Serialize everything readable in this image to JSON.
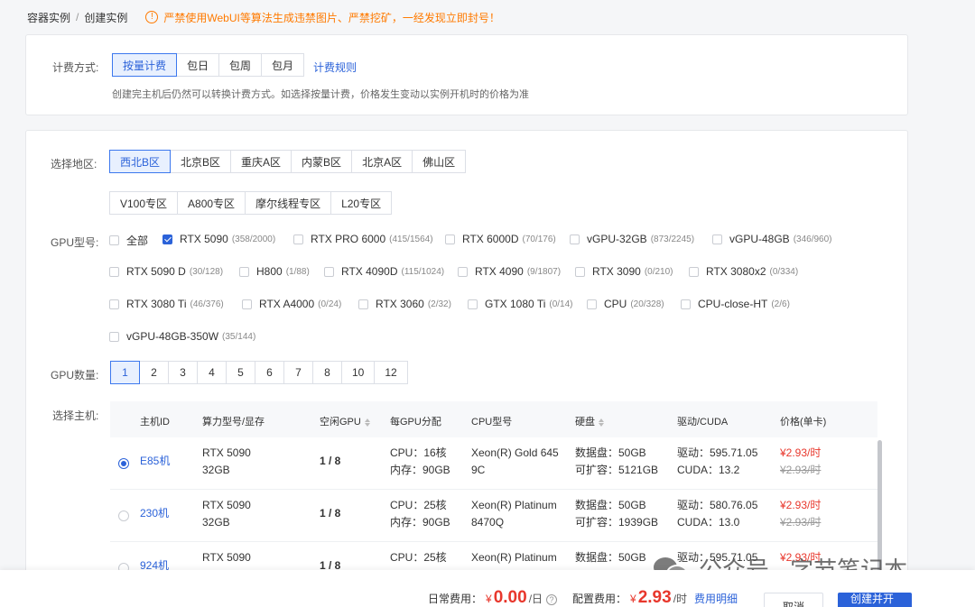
{
  "breadcrumb": {
    "parent": "容器实例",
    "sep": "/",
    "current": "创建实例"
  },
  "warning": {
    "icon": "exclamation-circle-icon",
    "text": "严禁使用WebUI等算法生成违禁图片、严禁挖矿，一经发现立即封号！"
  },
  "billing": {
    "label": "计费方式:",
    "options": [
      "按量计费",
      "包日",
      "包周",
      "包月"
    ],
    "selected": "按量计费",
    "rules_link": "计费规则",
    "hint": "创建完主机后仍然可以转换计费方式。如选择按量计费，价格发生变动以实例开机时的价格为准"
  },
  "region": {
    "label": "选择地区:",
    "row1": [
      "西北B区",
      "北京B区",
      "重庆A区",
      "内蒙B区",
      "北京A区",
      "佛山区"
    ],
    "row2": [
      "V100专区",
      "A800专区",
      "摩尔线程专区",
      "L20专区"
    ],
    "selected": "西北B区"
  },
  "gpu_type": {
    "label": "GPU型号:",
    "items": [
      {
        "name": "全部",
        "count": "",
        "checked": false
      },
      {
        "name": "RTX 5090",
        "count": "(358/2000)",
        "checked": true
      },
      {
        "name": "RTX PRO 6000",
        "count": "(415/1564)",
        "checked": false
      },
      {
        "name": "RTX 6000D",
        "count": "(70/176)",
        "checked": false
      },
      {
        "name": "vGPU-32GB",
        "count": "(873/2245)",
        "checked": false
      },
      {
        "name": "vGPU-48GB",
        "count": "(346/960)",
        "checked": false
      },
      {
        "name": "RTX 5090 D",
        "count": "(30/128)",
        "checked": false
      },
      {
        "name": "H800",
        "count": "(1/88)",
        "checked": false
      },
      {
        "name": "RTX 4090D",
        "count": "(115/1024)",
        "checked": false
      },
      {
        "name": "RTX 4090",
        "count": "(9/1807)",
        "checked": false
      },
      {
        "name": "RTX 3090",
        "count": "(0/210)",
        "checked": false
      },
      {
        "name": "RTX 3080x2",
        "count": "(0/334)",
        "checked": false
      },
      {
        "name": "RTX 3080 Ti",
        "count": "(46/376)",
        "checked": false
      },
      {
        "name": "RTX A4000",
        "count": "(0/24)",
        "checked": false
      },
      {
        "name": "RTX 3060",
        "count": "(2/32)",
        "checked": false
      },
      {
        "name": "GTX 1080 Ti",
        "count": "(0/14)",
        "checked": false
      },
      {
        "name": "CPU",
        "count": "(20/328)",
        "checked": false
      },
      {
        "name": "CPU-close-HT",
        "count": "(2/6)",
        "checked": false
      },
      {
        "name": "vGPU-48GB-350W",
        "count": "(35/144)",
        "checked": false
      }
    ]
  },
  "gpu_count": {
    "label": "GPU数量:",
    "options": [
      "1",
      "2",
      "3",
      "4",
      "5",
      "6",
      "7",
      "8",
      "10",
      "12"
    ],
    "selected": "1"
  },
  "host": {
    "label": "选择主机:",
    "columns": [
      "主机ID",
      "算力型号/显存",
      "空闲GPU",
      "每GPU分配",
      "CPU型号",
      "硬盘",
      "驱动/CUDA",
      "价格(单卡)"
    ],
    "rows": [
      {
        "id": "E85机",
        "model": "RTX 5090",
        "vram": "32GB",
        "free": "1 / 8",
        "cpu_alloc": "CPU：16核",
        "mem_alloc": "内存：90GB",
        "cpu_model1": "Xeon(R) Gold 645",
        "cpu_model2": "9C",
        "disk1": "数据盘：50GB",
        "disk2": "可扩容：5121GB",
        "driver": "驱动：595.71.05",
        "cuda": "CUDA：13.2",
        "price": "¥2.93/时",
        "price_old": "¥2.93/时",
        "selected": true
      },
      {
        "id": "230机",
        "model": "RTX 5090",
        "vram": "32GB",
        "free": "1 / 8",
        "cpu_alloc": "CPU：25核",
        "mem_alloc": "内存：90GB",
        "cpu_model1": "Xeon(R) Platinum",
        "cpu_model2": "8470Q",
        "disk1": "数据盘：50GB",
        "disk2": "可扩容：1939GB",
        "driver": "驱动：580.76.05",
        "cuda": "CUDA：13.0",
        "price": "¥2.93/时",
        "price_old": "¥2.93/时",
        "selected": false
      },
      {
        "id": "924机",
        "model": "RTX 5090",
        "vram": "",
        "free": "1 / 8",
        "cpu_alloc": "CPU：25核",
        "mem_alloc": "",
        "cpu_model1": "Xeon(R) Platinum",
        "cpu_model2": "",
        "disk1": "数据盘：50GB",
        "disk2": "",
        "driver": "驱动：595.71.05",
        "cuda": "",
        "price": "¥2.93/时",
        "price_old": "",
        "selected": false
      }
    ]
  },
  "footer": {
    "daily_label": "日常费用：",
    "daily_yen": "¥",
    "daily_value": "0.00",
    "daily_unit": "/日",
    "config_label": "配置费用：",
    "config_yen": "¥",
    "config_value": "2.93",
    "config_unit": "/时",
    "detail_link": "费用明细",
    "cancel": "取消",
    "create": "创建并开机"
  },
  "watermark": {
    "text": "公众号 · 字节笔记本",
    "icon": "wechat-icon"
  },
  "colors": {
    "accent": "#2b62d9",
    "price": "#e8372c",
    "warning": "#ff7a00"
  }
}
